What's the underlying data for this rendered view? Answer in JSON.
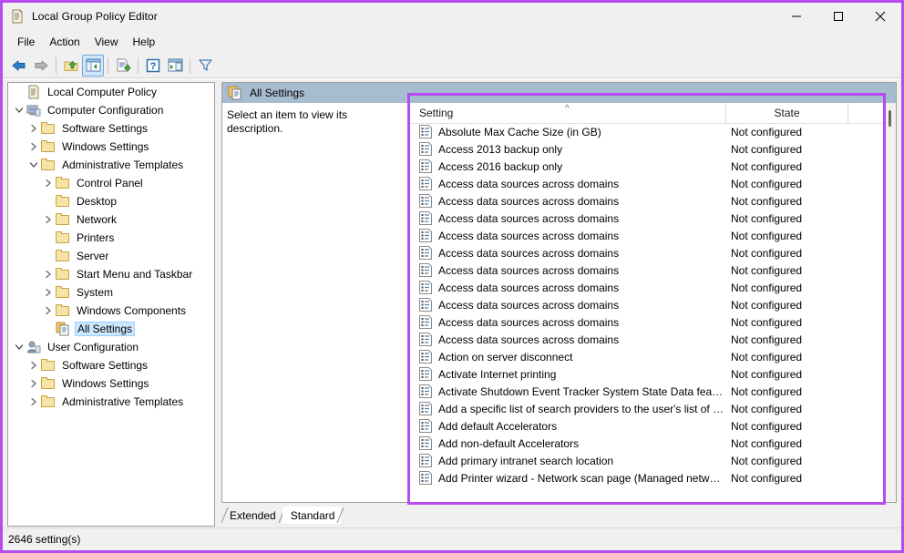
{
  "window": {
    "title": "Local Group Policy Editor",
    "icon": "policy-document-icon",
    "controls": {
      "minimize": "minimize-icon",
      "maximize": "maximize-icon",
      "close": "close-icon"
    }
  },
  "menu": {
    "items": [
      {
        "label": "File"
      },
      {
        "label": "Action"
      },
      {
        "label": "View"
      },
      {
        "label": "Help"
      }
    ]
  },
  "toolbar": {
    "buttons": [
      {
        "name": "back-icon"
      },
      {
        "name": "forward-icon"
      },
      {
        "name": "up-one-level-icon"
      },
      {
        "name": "show-hide-console-tree-icon",
        "selected": true
      },
      {
        "name": "export-list-icon"
      },
      {
        "name": "help-icon"
      },
      {
        "name": "properties-icon"
      },
      {
        "name": "filter-icon"
      }
    ]
  },
  "tree": {
    "items": [
      {
        "label": "Local Computer Policy",
        "indent": 0,
        "twisty": "",
        "icon": "policy-document-icon",
        "selected": false
      },
      {
        "label": "Computer Configuration",
        "indent": 0,
        "twisty": "expanded",
        "icon": "computer-icon",
        "selected": false
      },
      {
        "label": "Software Settings",
        "indent": 1,
        "twisty": "collapsed",
        "icon": "folder-icon",
        "selected": false
      },
      {
        "label": "Windows Settings",
        "indent": 1,
        "twisty": "collapsed",
        "icon": "folder-icon",
        "selected": false
      },
      {
        "label": "Administrative Templates",
        "indent": 1,
        "twisty": "expanded",
        "icon": "folder-icon",
        "selected": false
      },
      {
        "label": "Control Panel",
        "indent": 2,
        "twisty": "collapsed",
        "icon": "folder-icon",
        "selected": false
      },
      {
        "label": "Desktop",
        "indent": 2,
        "twisty": "",
        "icon": "folder-icon",
        "selected": false
      },
      {
        "label": "Network",
        "indent": 2,
        "twisty": "collapsed",
        "icon": "folder-icon",
        "selected": false
      },
      {
        "label": "Printers",
        "indent": 2,
        "twisty": "",
        "icon": "folder-icon",
        "selected": false
      },
      {
        "label": "Server",
        "indent": 2,
        "twisty": "",
        "icon": "folder-icon",
        "selected": false
      },
      {
        "label": "Start Menu and Taskbar",
        "indent": 2,
        "twisty": "collapsed",
        "icon": "folder-icon",
        "selected": false
      },
      {
        "label": "System",
        "indent": 2,
        "twisty": "collapsed",
        "icon": "folder-icon",
        "selected": false
      },
      {
        "label": "Windows Components",
        "indent": 2,
        "twisty": "collapsed",
        "icon": "folder-icon",
        "selected": false
      },
      {
        "label": "All Settings",
        "indent": 2,
        "twisty": "",
        "icon": "all-settings-icon",
        "selected": true
      },
      {
        "label": "User Configuration",
        "indent": 0,
        "twisty": "expanded",
        "icon": "user-icon",
        "selected": false
      },
      {
        "label": "Software Settings",
        "indent": 1,
        "twisty": "collapsed",
        "icon": "folder-icon",
        "selected": false
      },
      {
        "label": "Windows Settings",
        "indent": 1,
        "twisty": "collapsed",
        "icon": "folder-icon",
        "selected": false
      },
      {
        "label": "Administrative Templates",
        "indent": 1,
        "twisty": "collapsed",
        "icon": "folder-icon",
        "selected": false
      }
    ]
  },
  "right_pane": {
    "header_title": "All Settings",
    "header_icon": "all-settings-icon",
    "description": "Select an item to view its description.",
    "columns": [
      {
        "label": "Setting",
        "sort": "ascending"
      },
      {
        "label": "State"
      }
    ],
    "rows": [
      {
        "setting": "Absolute Max Cache Size (in GB)",
        "state": "Not configured"
      },
      {
        "setting": "Access 2013 backup only",
        "state": "Not configured"
      },
      {
        "setting": "Access 2016 backup only",
        "state": "Not configured"
      },
      {
        "setting": "Access data sources across domains",
        "state": "Not configured"
      },
      {
        "setting": "Access data sources across domains",
        "state": "Not configured"
      },
      {
        "setting": "Access data sources across domains",
        "state": "Not configured"
      },
      {
        "setting": "Access data sources across domains",
        "state": "Not configured"
      },
      {
        "setting": "Access data sources across domains",
        "state": "Not configured"
      },
      {
        "setting": "Access data sources across domains",
        "state": "Not configured"
      },
      {
        "setting": "Access data sources across domains",
        "state": "Not configured"
      },
      {
        "setting": "Access data sources across domains",
        "state": "Not configured"
      },
      {
        "setting": "Access data sources across domains",
        "state": "Not configured"
      },
      {
        "setting": "Access data sources across domains",
        "state": "Not configured"
      },
      {
        "setting": "Action on server disconnect",
        "state": "Not configured"
      },
      {
        "setting": "Activate Internet printing",
        "state": "Not configured"
      },
      {
        "setting": "Activate Shutdown Event Tracker System State Data feature",
        "state": "Not configured"
      },
      {
        "setting": "Add a specific list of search providers to the user's list of sea...",
        "state": "Not configured"
      },
      {
        "setting": "Add default Accelerators",
        "state": "Not configured"
      },
      {
        "setting": "Add non-default Accelerators",
        "state": "Not configured"
      },
      {
        "setting": "Add primary intranet search location",
        "state": "Not configured"
      },
      {
        "setting": "Add Printer wizard - Network scan page (Managed network)",
        "state": "Not configured"
      }
    ]
  },
  "tabs": [
    {
      "label": "Extended",
      "active": false
    },
    {
      "label": "Standard",
      "active": true
    }
  ],
  "statusbar": {
    "text": "2646 setting(s)"
  },
  "colors": {
    "highlight_border": "#b44cf0",
    "pane_header": "#a8bcd0",
    "selection": "#cce8ff"
  }
}
